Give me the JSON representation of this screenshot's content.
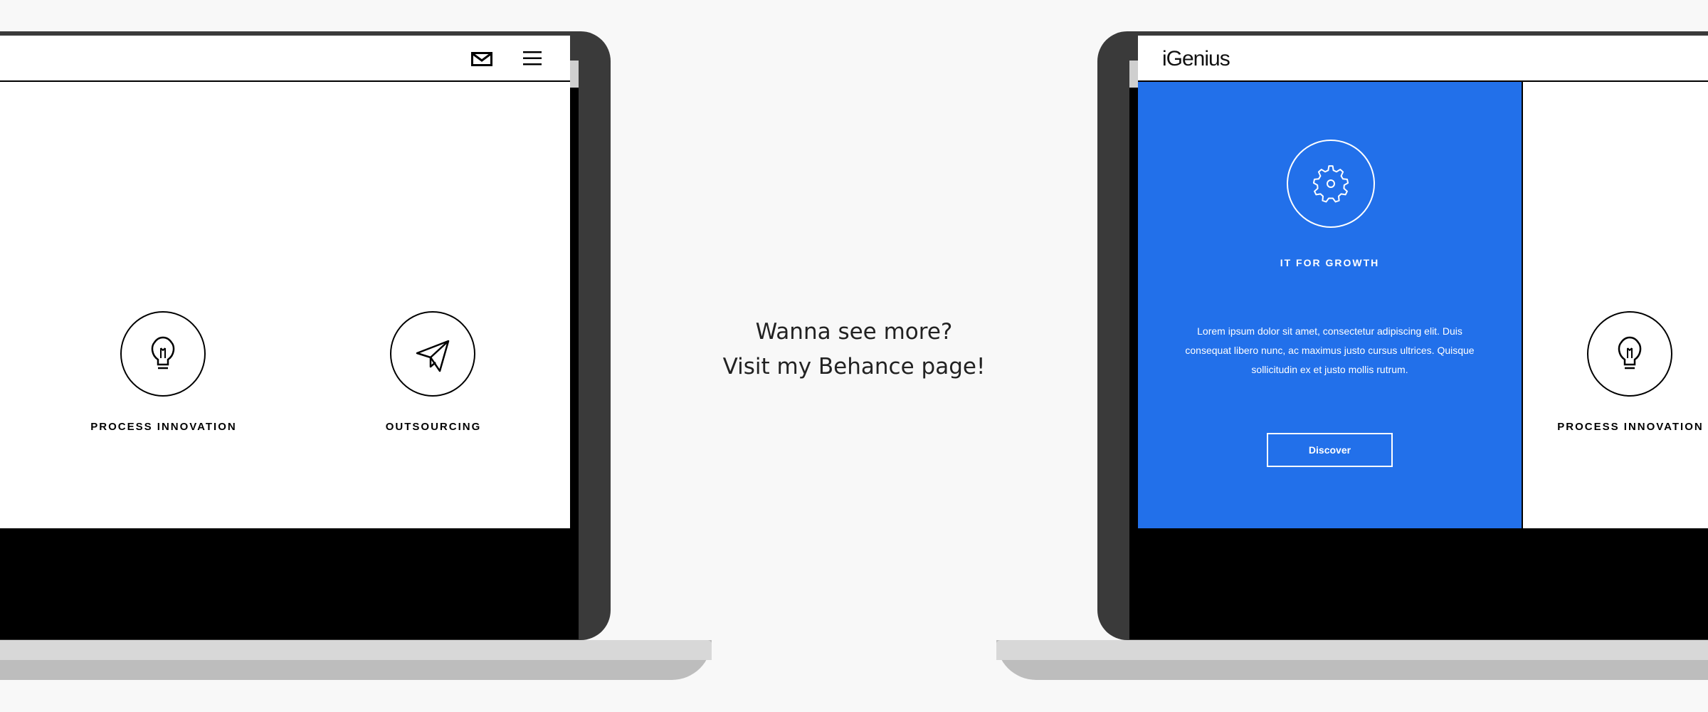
{
  "left_laptop": {
    "services": [
      {
        "icon": "lightbulb-icon",
        "label": "PROCESS INNOVATION"
      },
      {
        "icon": "paper-plane-icon",
        "label": "OUTSOURCING"
      }
    ],
    "header_icons": [
      "mail-icon",
      "hamburger-menu-icon"
    ]
  },
  "center": {
    "line1": "Wanna see more?",
    "line2": "Visit my Behance page!"
  },
  "right_laptop": {
    "logo": "iGenius",
    "window_controls": [
      "#e85b5b",
      "#e3d44a",
      "#55c15a"
    ],
    "feature": {
      "icon": "gear-icon",
      "title": "IT FOR GROWTH",
      "text": "Lorem ipsum dolor sit amet, consectetur adipiscing elit. Duis consequat libero nunc, ac maximus justo cursus ultrices. Quisque sollicitudin ex et justo mollis rutrum.",
      "button_label": "Discover",
      "background_color": "#2270ea"
    },
    "services": [
      {
        "icon": "lightbulb-icon",
        "label": "PROCESS INNOVATION"
      }
    ]
  }
}
